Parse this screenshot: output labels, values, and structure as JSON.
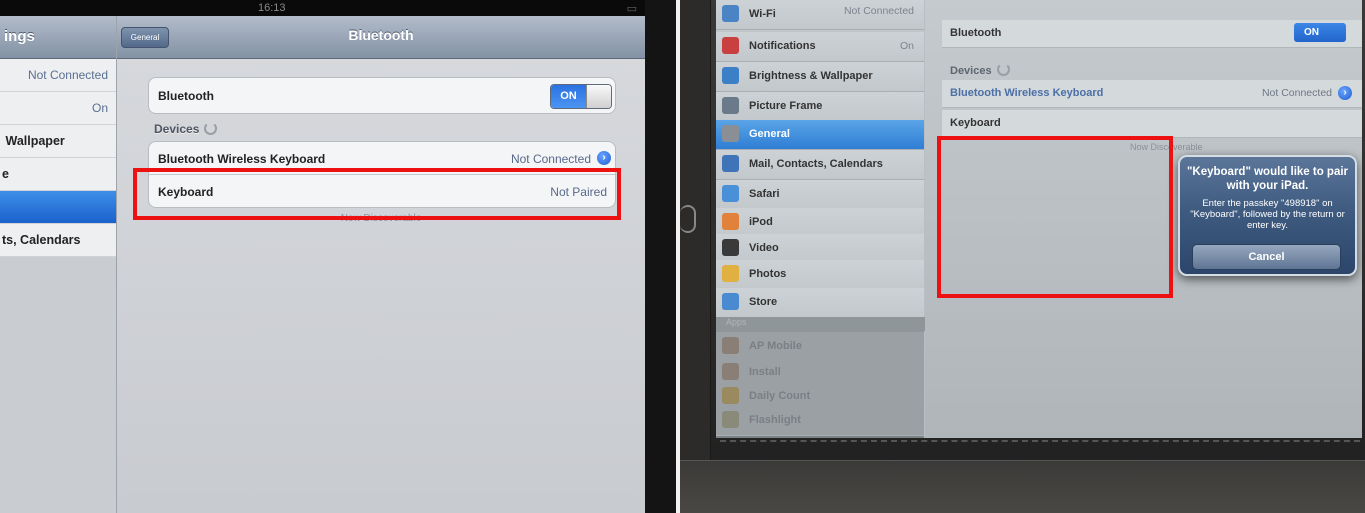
{
  "left_photo": {
    "status_bar": {
      "time": "16:13",
      "battery": ""
    },
    "master": {
      "title": "ings",
      "items": [
        {
          "label": "",
          "value": "Not Connected"
        },
        {
          "label": "",
          "value": "On"
        },
        {
          "label": "Wallpaper",
          "value": ""
        },
        {
          "label": "e",
          "value": ""
        },
        {
          "label": "",
          "value": "",
          "selected": true
        },
        {
          "label": "ts, Calendars",
          "value": ""
        }
      ]
    },
    "detail": {
      "back_label": "General",
      "title": "Bluetooth",
      "bluetooth_label": "Bluetooth",
      "toggle_label": "ON",
      "devices_header": "Devices",
      "devices": [
        {
          "name": "Bluetooth Wireless Keyboard",
          "status": "Not Connected"
        },
        {
          "name": "Keyboard",
          "status": "Not Paired"
        }
      ],
      "discoverable": "Now Discoverable"
    }
  },
  "right_photo": {
    "master": {
      "items": [
        {
          "label": "Wi-Fi",
          "value": "Not Connected",
          "color": "#4a84c4"
        },
        {
          "label": "Notifications",
          "value": "On",
          "color": "#c84040"
        },
        {
          "label": "Brightness & Wallpaper",
          "value": "",
          "color": "#3b7fc7"
        },
        {
          "label": "Picture Frame",
          "value": "",
          "color": "#6a7a8a"
        },
        {
          "label": "General",
          "value": "",
          "color": "#8a8f96",
          "selected": true
        },
        {
          "label": "Mail, Contacts, Calendars",
          "value": "",
          "color": "#3f74b8"
        },
        {
          "label": "Safari",
          "value": "",
          "color": "#4a90d8"
        },
        {
          "label": "iPod",
          "value": "",
          "color": "#e0823c"
        },
        {
          "label": "Video",
          "value": "",
          "color": "#3a3a3a"
        },
        {
          "label": "Photos",
          "value": "",
          "color": "#e0b040"
        },
        {
          "label": "Store",
          "value": "",
          "color": "#4a8ad0"
        }
      ],
      "apps_header": "Apps",
      "app_items": [
        {
          "label": "AP Mobile"
        },
        {
          "label": "Install"
        },
        {
          "label": "Daily Count"
        },
        {
          "label": "Flashlight"
        }
      ]
    },
    "detail": {
      "bluetooth_label": "Bluetooth",
      "toggle_label": "ON",
      "devices_header": "Devices",
      "devices": [
        {
          "name": "Bluetooth Wireless Keyboard",
          "status": "Not Connected"
        },
        {
          "name": "Keyboard",
          "status": ""
        }
      ],
      "discoverable": "Now Discoverable"
    },
    "alert": {
      "title": "\"Keyboard\" would like to pair with your iPad.",
      "message": "Enter the passkey \"498918\" on \"Keyboard\", followed by the return or enter key.",
      "cancel_label": "Cancel"
    }
  },
  "colors": {
    "highlight": "#ee1111",
    "accent": "#2a72e0"
  }
}
